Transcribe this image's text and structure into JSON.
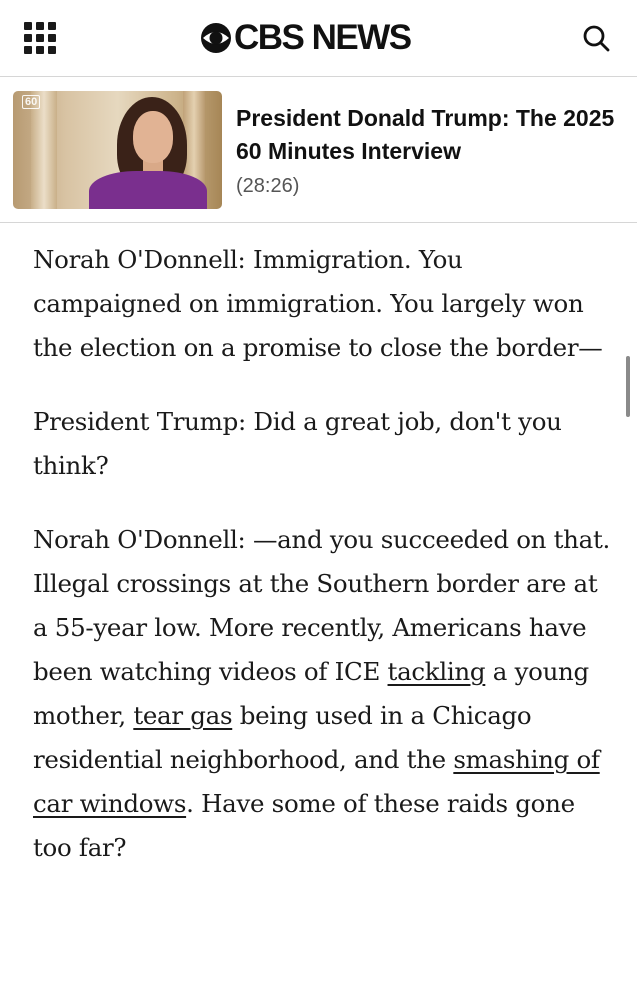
{
  "header": {
    "menu_icon": "grid-menu-icon",
    "logo_text": "CBS NEWS",
    "search_icon": "search-icon"
  },
  "video": {
    "thumbnail_badge": "60",
    "title": "President Donald Trump: The 2025 60 Minutes Interview",
    "duration": "(28:26)"
  },
  "article": {
    "p1": "Norah O'Donnell: Immigration. You campaigned on immigration. You largely won the election on a promise to close the border—",
    "p2": "President Trump: Did a great job, don't you think?",
    "p3": {
      "t1": "Norah O'Donnell: —and you succeeded on that. Illegal crossings at the Southern border are at a 55-year low. More recently, Americans have been watching videos of ICE ",
      "link1": "tackling",
      "t2": " a young mother, ",
      "link2": "tear gas",
      "t3": " being used in a Chicago residential neighborhood, and the ",
      "link3": "smashing of car windows",
      "t4": ". Have some of these raids gone too far?"
    }
  },
  "colors": {
    "text": "#1a1a1a",
    "divider": "#d6d6d6",
    "secondary_text": "#555555"
  }
}
